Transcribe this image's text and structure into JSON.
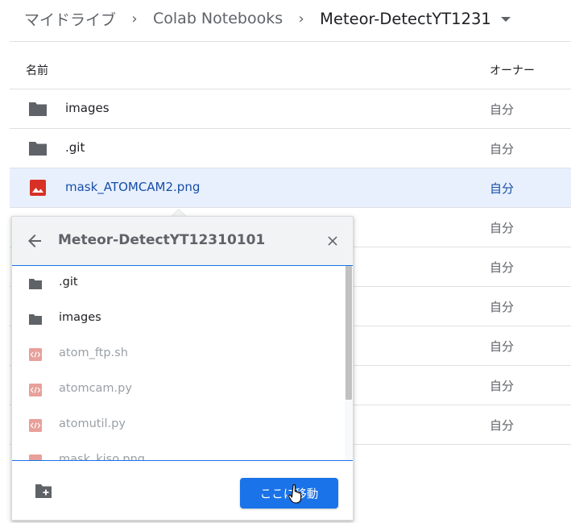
{
  "breadcrumb": {
    "items": [
      "マイドライブ",
      "Colab Notebooks",
      "Meteor-DetectYT1231"
    ],
    "separator": "›"
  },
  "table": {
    "header_name": "名前",
    "header_owner": "オーナー"
  },
  "files": [
    {
      "name": "images",
      "owner": "自分",
      "icon": "folder-icon"
    },
    {
      "name": ".git",
      "owner": "自分",
      "icon": "folder-icon"
    },
    {
      "name": "mask_ATOMCAM2.png",
      "owner": "自分",
      "icon": "image-file-icon",
      "selected": true
    },
    {
      "name": "",
      "owner": "自分"
    },
    {
      "name": "",
      "owner": "自分"
    },
    {
      "name": "",
      "owner": "自分"
    },
    {
      "name": "",
      "owner": "自分"
    },
    {
      "name": "",
      "owner": "自分"
    },
    {
      "name": "",
      "owner": "自分"
    }
  ],
  "move_dialog": {
    "title": "Meteor-DetectYT12310101",
    "items": [
      {
        "name": ".git",
        "icon": "folder-icon",
        "disabled": false
      },
      {
        "name": "images",
        "icon": "folder-icon",
        "disabled": false
      },
      {
        "name": "atom_ftp.sh",
        "icon": "code-file-icon",
        "disabled": true
      },
      {
        "name": "atomcam.py",
        "icon": "code-file-icon",
        "disabled": true
      },
      {
        "name": "atomutil.py",
        "icon": "code-file-icon",
        "disabled": true
      },
      {
        "name": "mask_kiso.png",
        "icon": "image-file-icon",
        "disabled": true
      }
    ],
    "move_button_label": "ここに移動"
  },
  "colors": {
    "accent": "#1a73e8",
    "selected_row": "#e8f0fe",
    "folder": "#5f6368",
    "image_file": "#d93025",
    "code_file": "#e8a09a"
  }
}
